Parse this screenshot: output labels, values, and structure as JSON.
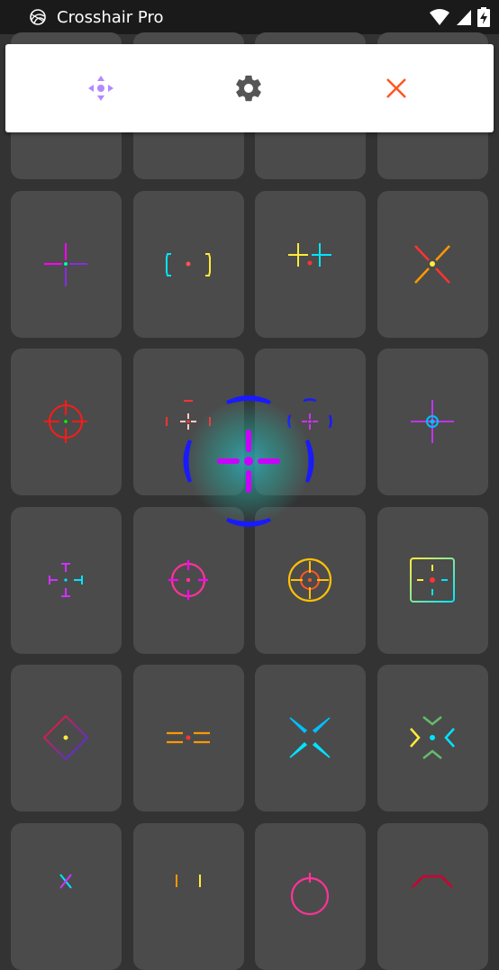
{
  "status_bar": {
    "app_title": "Crosshair Pro",
    "icons": [
      "app-logo-icon",
      "wifi-icon",
      "cell-signal-icon",
      "battery-charging-icon"
    ]
  },
  "toolbar": {
    "buttons": [
      {
        "name": "move-button",
        "icon": "move-arrows-icon",
        "color": "#b388ff"
      },
      {
        "name": "settings-button",
        "icon": "gear-icon",
        "color": "#555555"
      },
      {
        "name": "close-button",
        "icon": "close-icon",
        "color": "#ff5722"
      }
    ]
  },
  "colors": {
    "background": "#333333",
    "tile": "#4b4b4b",
    "status_bar": "#1a1a1a"
  },
  "crosshair_grid": {
    "columns": 4,
    "tiles": [
      {
        "row": 1,
        "col": 1,
        "style": "plus-dot",
        "colors": [
          "#ff00ff",
          "#8a2be2",
          "#00ffaa"
        ]
      },
      {
        "row": 1,
        "col": 2,
        "style": "brackets-dot",
        "colors": [
          "#00e5ff",
          "#ffeb3b",
          "#ff5252"
        ]
      },
      {
        "row": 1,
        "col": 3,
        "style": "double-bar",
        "colors": [
          "#ffeb3b",
          "#00e5ff",
          "#ff3333"
        ]
      },
      {
        "row": 1,
        "col": 4,
        "style": "x-dot",
        "colors": [
          "#ff3333",
          "#ff9800",
          "#ffeb3b"
        ]
      },
      {
        "row": 2,
        "col": 1,
        "style": "circle-scope",
        "colors": [
          "#ff1a1a",
          "#00ff00"
        ]
      },
      {
        "row": 2,
        "col": 2,
        "style": "corner-plus",
        "colors": [
          "#ff3333",
          "#ffcccc"
        ]
      },
      {
        "row": 2,
        "col": 3,
        "style": "bracket-plus",
        "colors": [
          "#1a1aff",
          "#cc33ff"
        ]
      },
      {
        "row": 2,
        "col": 4,
        "style": "target-plus",
        "colors": [
          "#cc33ff",
          "#00bfff"
        ]
      },
      {
        "row": 3,
        "col": 1,
        "style": "t-arrows",
        "colors": [
          "#cc33ff",
          "#00e5ff"
        ]
      },
      {
        "row": 3,
        "col": 2,
        "style": "circle-plus",
        "colors": [
          "#ff3399",
          "#ff00ff"
        ]
      },
      {
        "row": 3,
        "col": 3,
        "style": "double-circle",
        "colors": [
          "#ffc107",
          "#ff5722"
        ]
      },
      {
        "row": 3,
        "col": 4,
        "style": "square-dot",
        "colors": [
          "#ffeb3b",
          "#00e5ff",
          "#ff3333"
        ]
      },
      {
        "row": 4,
        "col": 1,
        "style": "diamond-dot",
        "colors": [
          "#ff1a1a",
          "#3333ff",
          "#ffeb3b"
        ]
      },
      {
        "row": 4,
        "col": 2,
        "style": "double-dash",
        "colors": [
          "#ff9800",
          "#ff3333"
        ]
      },
      {
        "row": 4,
        "col": 3,
        "style": "slant-x",
        "colors": [
          "#00bfff",
          "#00e5ff"
        ]
      },
      {
        "row": 4,
        "col": 4,
        "style": "chevron-x",
        "colors": [
          "#ffeb3b",
          "#00e5ff",
          "#66bb6a"
        ]
      },
      {
        "row": 5,
        "col": 1,
        "style": "partial-x",
        "colors": [
          "#00e5ff",
          "#cc33ff"
        ]
      },
      {
        "row": 5,
        "col": 2,
        "style": "partial-bars",
        "colors": [
          "#ff9800",
          "#ffeb3b"
        ]
      },
      {
        "row": 5,
        "col": 3,
        "style": "partial-circle",
        "colors": [
          "#ff3399"
        ]
      },
      {
        "row": 5,
        "col": 4,
        "style": "partial-chevron",
        "colors": [
          "#cc0033"
        ]
      }
    ]
  },
  "drag_preview": {
    "style": "arc-plus",
    "colors": [
      "#1a1aff",
      "#cc00ff",
      "#26c6da"
    ]
  }
}
